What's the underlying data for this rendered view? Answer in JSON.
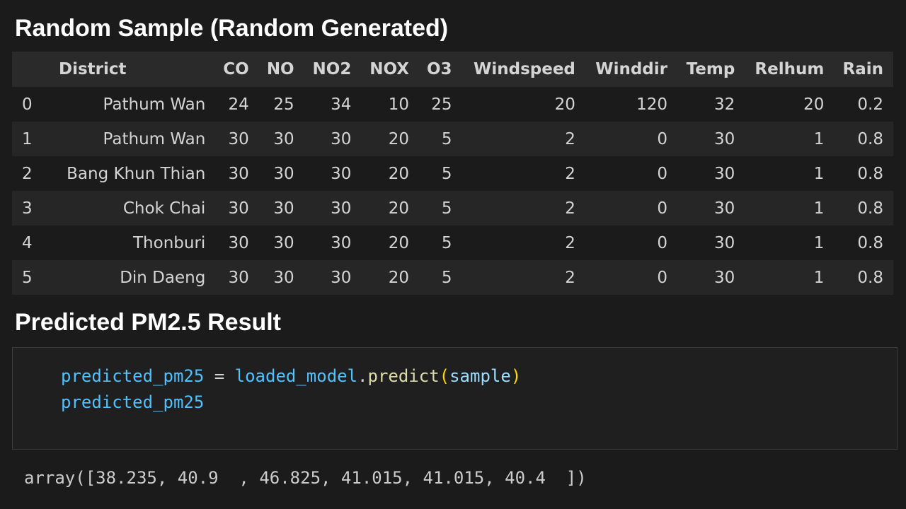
{
  "titles": {
    "sample": "Random Sample (Random Generated)",
    "result": "Predicted PM2.5 Result"
  },
  "table": {
    "columns": [
      "",
      "District",
      "CO",
      "NO",
      "NO2",
      "NOX",
      "O3",
      "Windspeed",
      "Winddir",
      "Temp",
      "Relhum",
      "Rain"
    ],
    "rows": [
      [
        "0",
        "Pathum Wan",
        "24",
        "25",
        "34",
        "10",
        "25",
        "20",
        "120",
        "32",
        "20",
        "0.2"
      ],
      [
        "1",
        "Pathum Wan",
        "30",
        "30",
        "30",
        "20",
        "5",
        "2",
        "0",
        "30",
        "1",
        "0.8"
      ],
      [
        "2",
        "Bang Khun Thian",
        "30",
        "30",
        "30",
        "20",
        "5",
        "2",
        "0",
        "30",
        "1",
        "0.8"
      ],
      [
        "3",
        "Chok Chai",
        "30",
        "30",
        "30",
        "20",
        "5",
        "2",
        "0",
        "30",
        "1",
        "0.8"
      ],
      [
        "4",
        "Thonburi",
        "30",
        "30",
        "30",
        "20",
        "5",
        "2",
        "0",
        "30",
        "1",
        "0.8"
      ],
      [
        "5",
        "Din Daeng",
        "30",
        "30",
        "30",
        "20",
        "5",
        "2",
        "0",
        "30",
        "1",
        "0.8"
      ]
    ]
  },
  "code": {
    "line1": {
      "var": "predicted_pm25",
      "op": " = ",
      "obj": "loaded_model",
      "dot": ".",
      "fn": "predict",
      "open": "(",
      "arg": "sample",
      "close": ")"
    },
    "line2": "predicted_pm25"
  },
  "output": "array([38.235, 40.9  , 46.825, 41.015, 41.015, 40.4  ])",
  "colors": {
    "background": "#1b1b1b",
    "variable": "#4fc1ff",
    "function": "#dcdcaa",
    "paren": "#ffd700"
  }
}
